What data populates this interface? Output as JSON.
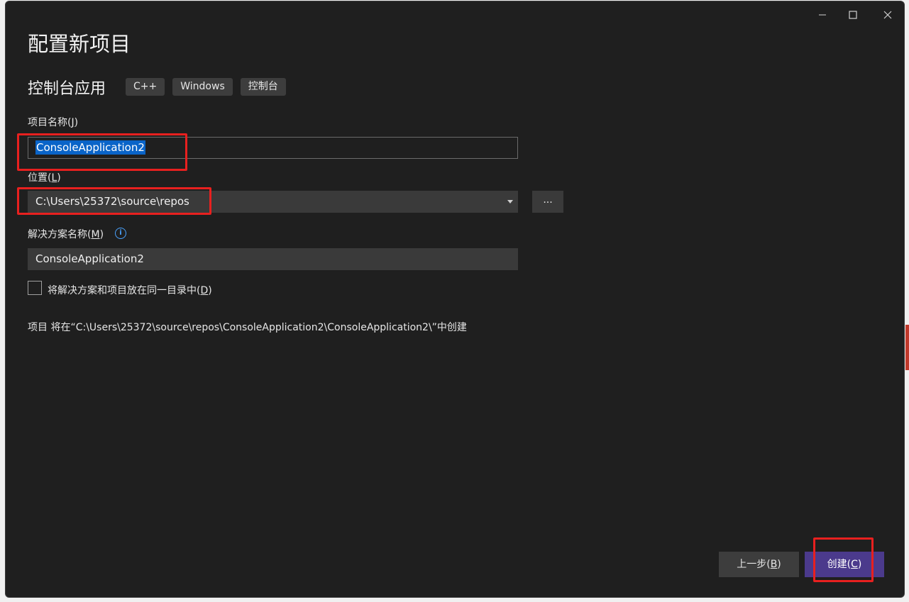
{
  "window": {
    "title": "配置新项目",
    "controls": {
      "minimize": "minimize-icon",
      "maximize": "maximize-icon",
      "close": "close-icon"
    }
  },
  "template": {
    "name": "控制台应用",
    "tags": [
      "C++",
      "Windows",
      "控制台"
    ]
  },
  "project_name": {
    "label": "项目名称",
    "accel": "J",
    "value": "ConsoleApplication2"
  },
  "location": {
    "label": "位置",
    "accel": "L",
    "value": "C:\\Users\\25372\\source\\repos",
    "browse_label": "..."
  },
  "solution_name": {
    "label": "解决方案名称",
    "accel": "M",
    "value": "ConsoleApplication2",
    "info_icon": "info-icon"
  },
  "same_dir": {
    "label": "将解决方案和项目放在同一目录中",
    "accel": "D",
    "checked": false
  },
  "path_note": "项目 将在“C:\\Users\\25372\\source\\repos\\ConsoleApplication2\\ConsoleApplication2\\”中创建",
  "buttons": {
    "back_label": "上一步",
    "back_accel": "B",
    "create_label": "创建",
    "create_accel": "C"
  },
  "colors": {
    "background": "#1f1f1f",
    "accent": "#4b3a8c",
    "selection": "#0a64c8",
    "highlight": "#e8201f"
  }
}
